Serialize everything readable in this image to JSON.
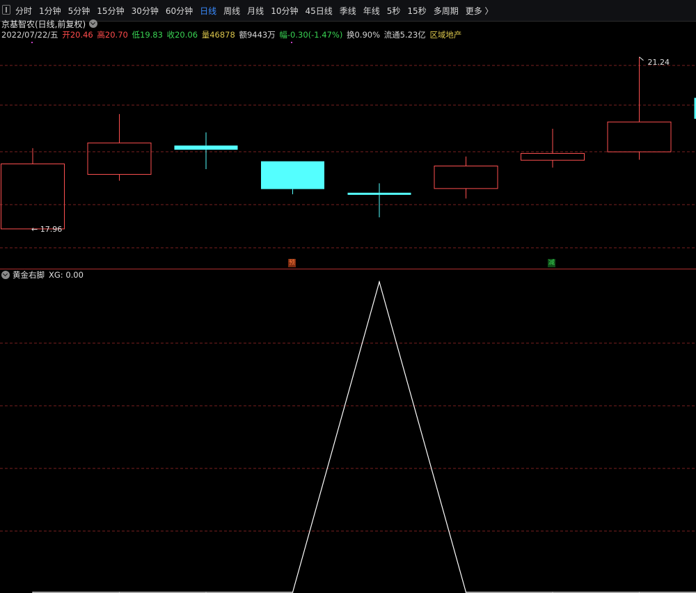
{
  "toolbar": {
    "items": [
      "分时",
      "1分钟",
      "5分钟",
      "15分钟",
      "30分钟",
      "60分钟",
      "日线",
      "周线",
      "月线",
      "10分钟",
      "45日线",
      "季线",
      "年线",
      "5秒",
      "15秒",
      "多周期",
      "更多 〉"
    ],
    "active": "日线"
  },
  "stock": {
    "title": "京基智农(日线,前复权)",
    "date": "2022/07/22/五",
    "open": "开20.46",
    "high": "高20.70",
    "low": "低19.83",
    "close": "收20.06",
    "volume": "量46878",
    "amount": "额9443万",
    "change": "幅-0.30(-1.47%)",
    "turnover": "换0.90%",
    "float": "流通5.23亿",
    "sector": "区域地产"
  },
  "colors": {
    "up": "#ff5050",
    "down": "#54ffff",
    "grid": "#7a1f1f",
    "divider": "#b03030",
    "line": "#ffffff",
    "active_tab": "#3a8cff"
  },
  "annotations": {
    "high_label": "21.24",
    "low_label": "17.96"
  },
  "markers": [
    {
      "text": "预",
      "color": "#ff7a3a"
    },
    {
      "text": "减",
      "color": "#39d353"
    }
  ],
  "indicator": {
    "name": "黄金右脚",
    "value_label": "XG: 0.00"
  },
  "chart_data": [
    {
      "type": "candlestick",
      "title": "京基智农(日线,前复权)",
      "candles": [
        {
          "open": 17.96,
          "close": 19.2,
          "high": 19.5,
          "low": 17.96
        },
        {
          "open": 19.0,
          "close": 19.6,
          "high": 20.15,
          "low": 18.88
        },
        {
          "open": 19.55,
          "close": 19.47,
          "high": 19.8,
          "low": 19.1
        },
        {
          "open": 19.25,
          "close": 18.72,
          "high": 19.25,
          "low": 18.62
        },
        {
          "open": 18.65,
          "close": 18.61,
          "high": 18.83,
          "low": 18.18
        },
        {
          "open": 18.73,
          "close": 19.16,
          "high": 19.34,
          "low": 18.54
        },
        {
          "open": 19.27,
          "close": 19.4,
          "high": 19.87,
          "low": 19.13
        },
        {
          "open": 19.43,
          "close": 20.0,
          "high": 21.24,
          "low": 19.28
        },
        {
          "open": 20.46,
          "close": 20.06,
          "high": 20.7,
          "low": 19.83
        }
      ],
      "labels": {
        "max": "21.24",
        "min": "17.96"
      },
      "grid": true
    },
    {
      "type": "line",
      "title": "黄金右脚",
      "series": [
        {
          "name": "XG",
          "values": [
            0,
            0,
            0,
            0,
            1,
            0,
            0,
            0,
            0
          ]
        }
      ],
      "ylim": [
        0,
        1
      ],
      "grid": true
    }
  ]
}
